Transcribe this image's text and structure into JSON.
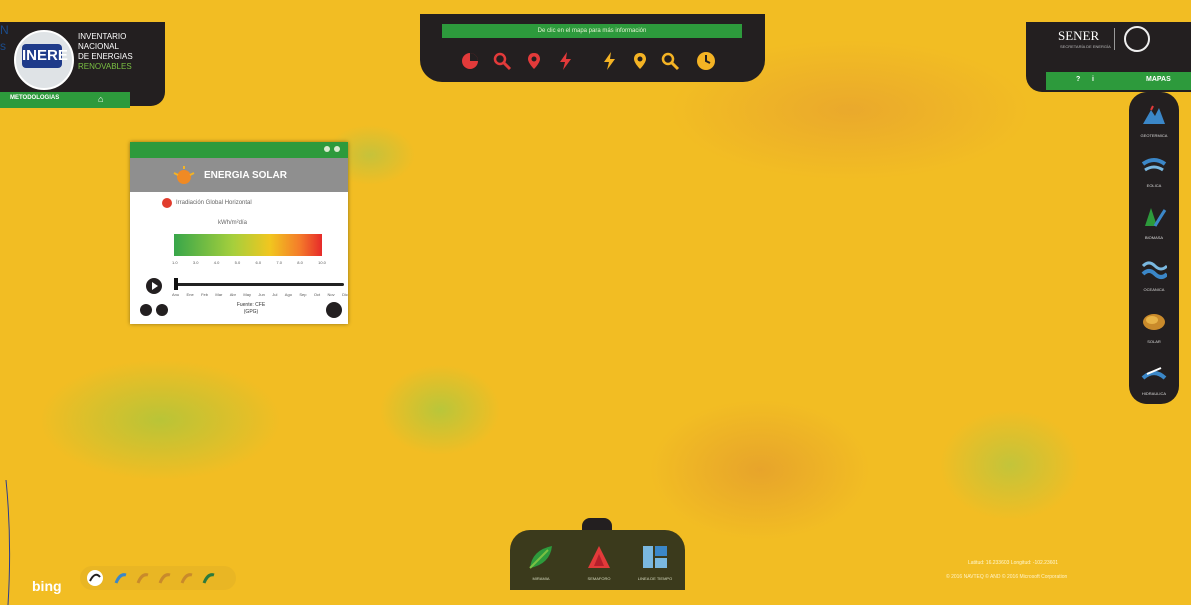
{
  "header": {
    "logo_badge": "INERE",
    "logo_line1": "INVENTARIO",
    "logo_line2": "NACIONAL",
    "logo_line3": "DE ENERGIAS",
    "logo_line4": "RENOVABLES",
    "left_edge": "N\ns",
    "left_bar_label": "METODOLOGIAS",
    "banner": "De clic en el mapa para más información",
    "org": "SENER",
    "org_sub": "SECRETARÍA DE ENERGÍA",
    "right_bar": [
      "?",
      "i",
      "MAPAS"
    ],
    "toolbar_icons": [
      "pie-chart-icon",
      "search-icon",
      "location-pin-icon",
      "lightning-icon",
      "lightning-icon",
      "location-pin-icon",
      "search-icon",
      "clock-icon"
    ]
  },
  "sidebar": {
    "items": [
      {
        "label": "GEOTERMICA",
        "icon": "geothermal-icon"
      },
      {
        "label": "EOLICA",
        "icon": "wind-icon"
      },
      {
        "label": "BIOMASA",
        "icon": "biomass-icon"
      },
      {
        "label": "OCEANICA",
        "icon": "ocean-icon"
      },
      {
        "label": "SOLAR",
        "icon": "solar-icon"
      },
      {
        "label": "HIDRAULICA",
        "icon": "hydro-icon"
      }
    ]
  },
  "panel": {
    "title": "ENERGIA SOLAR",
    "subtitle": "Irradiación Global Horizontal",
    "unit": "kWh/m²día",
    "scale_ticks": [
      "1.0",
      "3.0",
      "4.0",
      "5.0",
      "6.0",
      "7.0",
      "8.0",
      "10.0"
    ],
    "months": [
      "Anu",
      "Ene",
      "Feb",
      "Mar",
      "Abr",
      "May",
      "Jun",
      "Jul",
      "Ago",
      "Sep",
      "Oct",
      "Nov",
      "Dic"
    ],
    "source_line1": "Fuente: CFE",
    "source_line2": "(GPG)"
  },
  "bottom": {
    "items": [
      {
        "label": "MIRAMIA",
        "icon": "leaf-icon"
      },
      {
        "label": "SEMAFORO",
        "icon": "triangle-icon"
      },
      {
        "label": "LINEA DE TIEMPO",
        "icon": "grid-icon"
      }
    ]
  },
  "footer": {
    "bing": "bing",
    "coords": "Latitud: 16.233603 Longitud: -102.23601",
    "copyright": "© 2016 NAVTEQ  © AND  © 2016 Microsoft Corporation",
    "layer_icons": [
      "layer-1-icon",
      "layer-2-icon",
      "layer-3-icon",
      "layer-4-icon",
      "layer-5-icon",
      "layer-6-icon"
    ]
  },
  "colors": {
    "map_yellow": "#f2bd23",
    "brand_green": "#2d9a3c",
    "dark": "#231f20"
  }
}
